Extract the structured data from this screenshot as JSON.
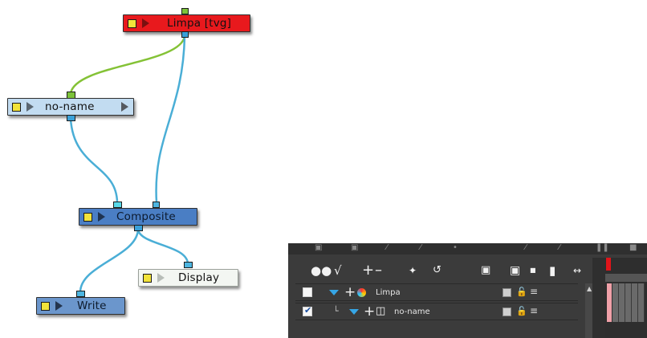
{
  "nodes": {
    "limpa": {
      "label": "Limpa [tvg]",
      "color": "#e8191d"
    },
    "noname": {
      "label": "no-name",
      "color": "#c2dcf1"
    },
    "composite": {
      "label": "Composite",
      "color": "#4a7ec4"
    },
    "display": {
      "label": "Display",
      "color": "#f3f6f2"
    },
    "write": {
      "label": "Write",
      "color": "#6b96cc"
    }
  },
  "wire_colors": {
    "green": "#84c236",
    "blue": "#4aaed6"
  },
  "timeline": {
    "toolbar_icons": [
      "onion-skin-icon",
      "onion-skin-settings-icon",
      "add-layer-icon",
      "remove-layer-icon",
      "add-effect-icon",
      "add-peg-icon",
      "show-all-icon",
      "lock-all-icon",
      "collapse-icon",
      "expand-icon",
      "split-icon"
    ],
    "layers": [
      {
        "name": "Limpa",
        "checked": false,
        "icon": "drawing-layer-icon"
      },
      {
        "name": "no-name",
        "checked": true,
        "icon": "peg-layer-icon"
      }
    ],
    "playhead_color": "#e0141a"
  }
}
